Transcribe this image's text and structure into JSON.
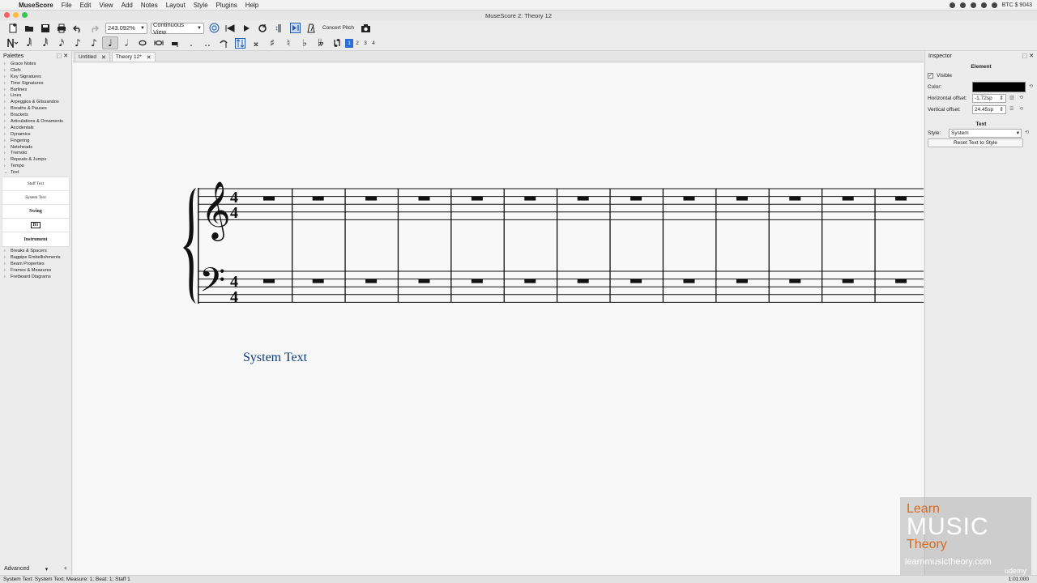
{
  "menubar": {
    "app": "MuseScore",
    "items": [
      "File",
      "Edit",
      "View",
      "Add",
      "Notes",
      "Layout",
      "Style",
      "Plugins",
      "Help"
    ],
    "status_right": "BTC $ 9043"
  },
  "window": {
    "title": "MuseScore 2: Theory 12"
  },
  "toolbar": {
    "zoom": "243.092%",
    "view_mode": "Continuous View",
    "concert_pitch": "Concert Pitch",
    "voices": [
      "1",
      "2",
      "3",
      "4"
    ]
  },
  "palettes": {
    "title": "Palettes",
    "items_top": [
      "Grace Notes",
      "Clefs",
      "Key Signatures",
      "Time Signatures",
      "Barlines",
      "Lines",
      "Arpeggios & Glissandos",
      "Breaths & Pauses",
      "Brackets",
      "Articulations & Ornaments",
      "Accidentals",
      "Dynamics",
      "Fingering",
      "Noteheads",
      "Tremolo",
      "Repeats & Jumps",
      "Tempo",
      "Text"
    ],
    "text_cells": [
      "Staff Text",
      "System Text",
      "Swing",
      "B1",
      "Instrument"
    ],
    "items_bottom": [
      "Breaks & Spacers",
      "Bagpipe Embellishments",
      "Beam Properties",
      "Frames & Measures",
      "Fretboard Diagrams"
    ],
    "mode": "Advanced"
  },
  "tabs": [
    {
      "label": "Untitled"
    },
    {
      "label": "Theory 12*"
    }
  ],
  "score": {
    "system_text": "System Text",
    "measure_count": 14
  },
  "inspector": {
    "title": "Inspector",
    "element_section": "Element",
    "visible_label": "Visible",
    "visible_checked": "✓",
    "color_label": "Color:",
    "color_value": "#000000",
    "h_offset_label": "Horizontal offset:",
    "h_offset": "-1.72sp",
    "v_offset_label": "Vertical offset:",
    "v_offset": "24.45sp",
    "text_section": "Text",
    "style_label": "Style:",
    "style_value": "System",
    "reset_button": "Reset Text to Style"
  },
  "statusbar": {
    "left": "System Text: System Text;  Measure: 1; Beat: 1; Staff 1",
    "right": "1:01:000"
  },
  "watermark": {
    "line1": "Learn",
    "line2": "MUSIC",
    "line3": "Theory",
    "url": "learnmusictheory.com",
    "platform": "udemy"
  }
}
